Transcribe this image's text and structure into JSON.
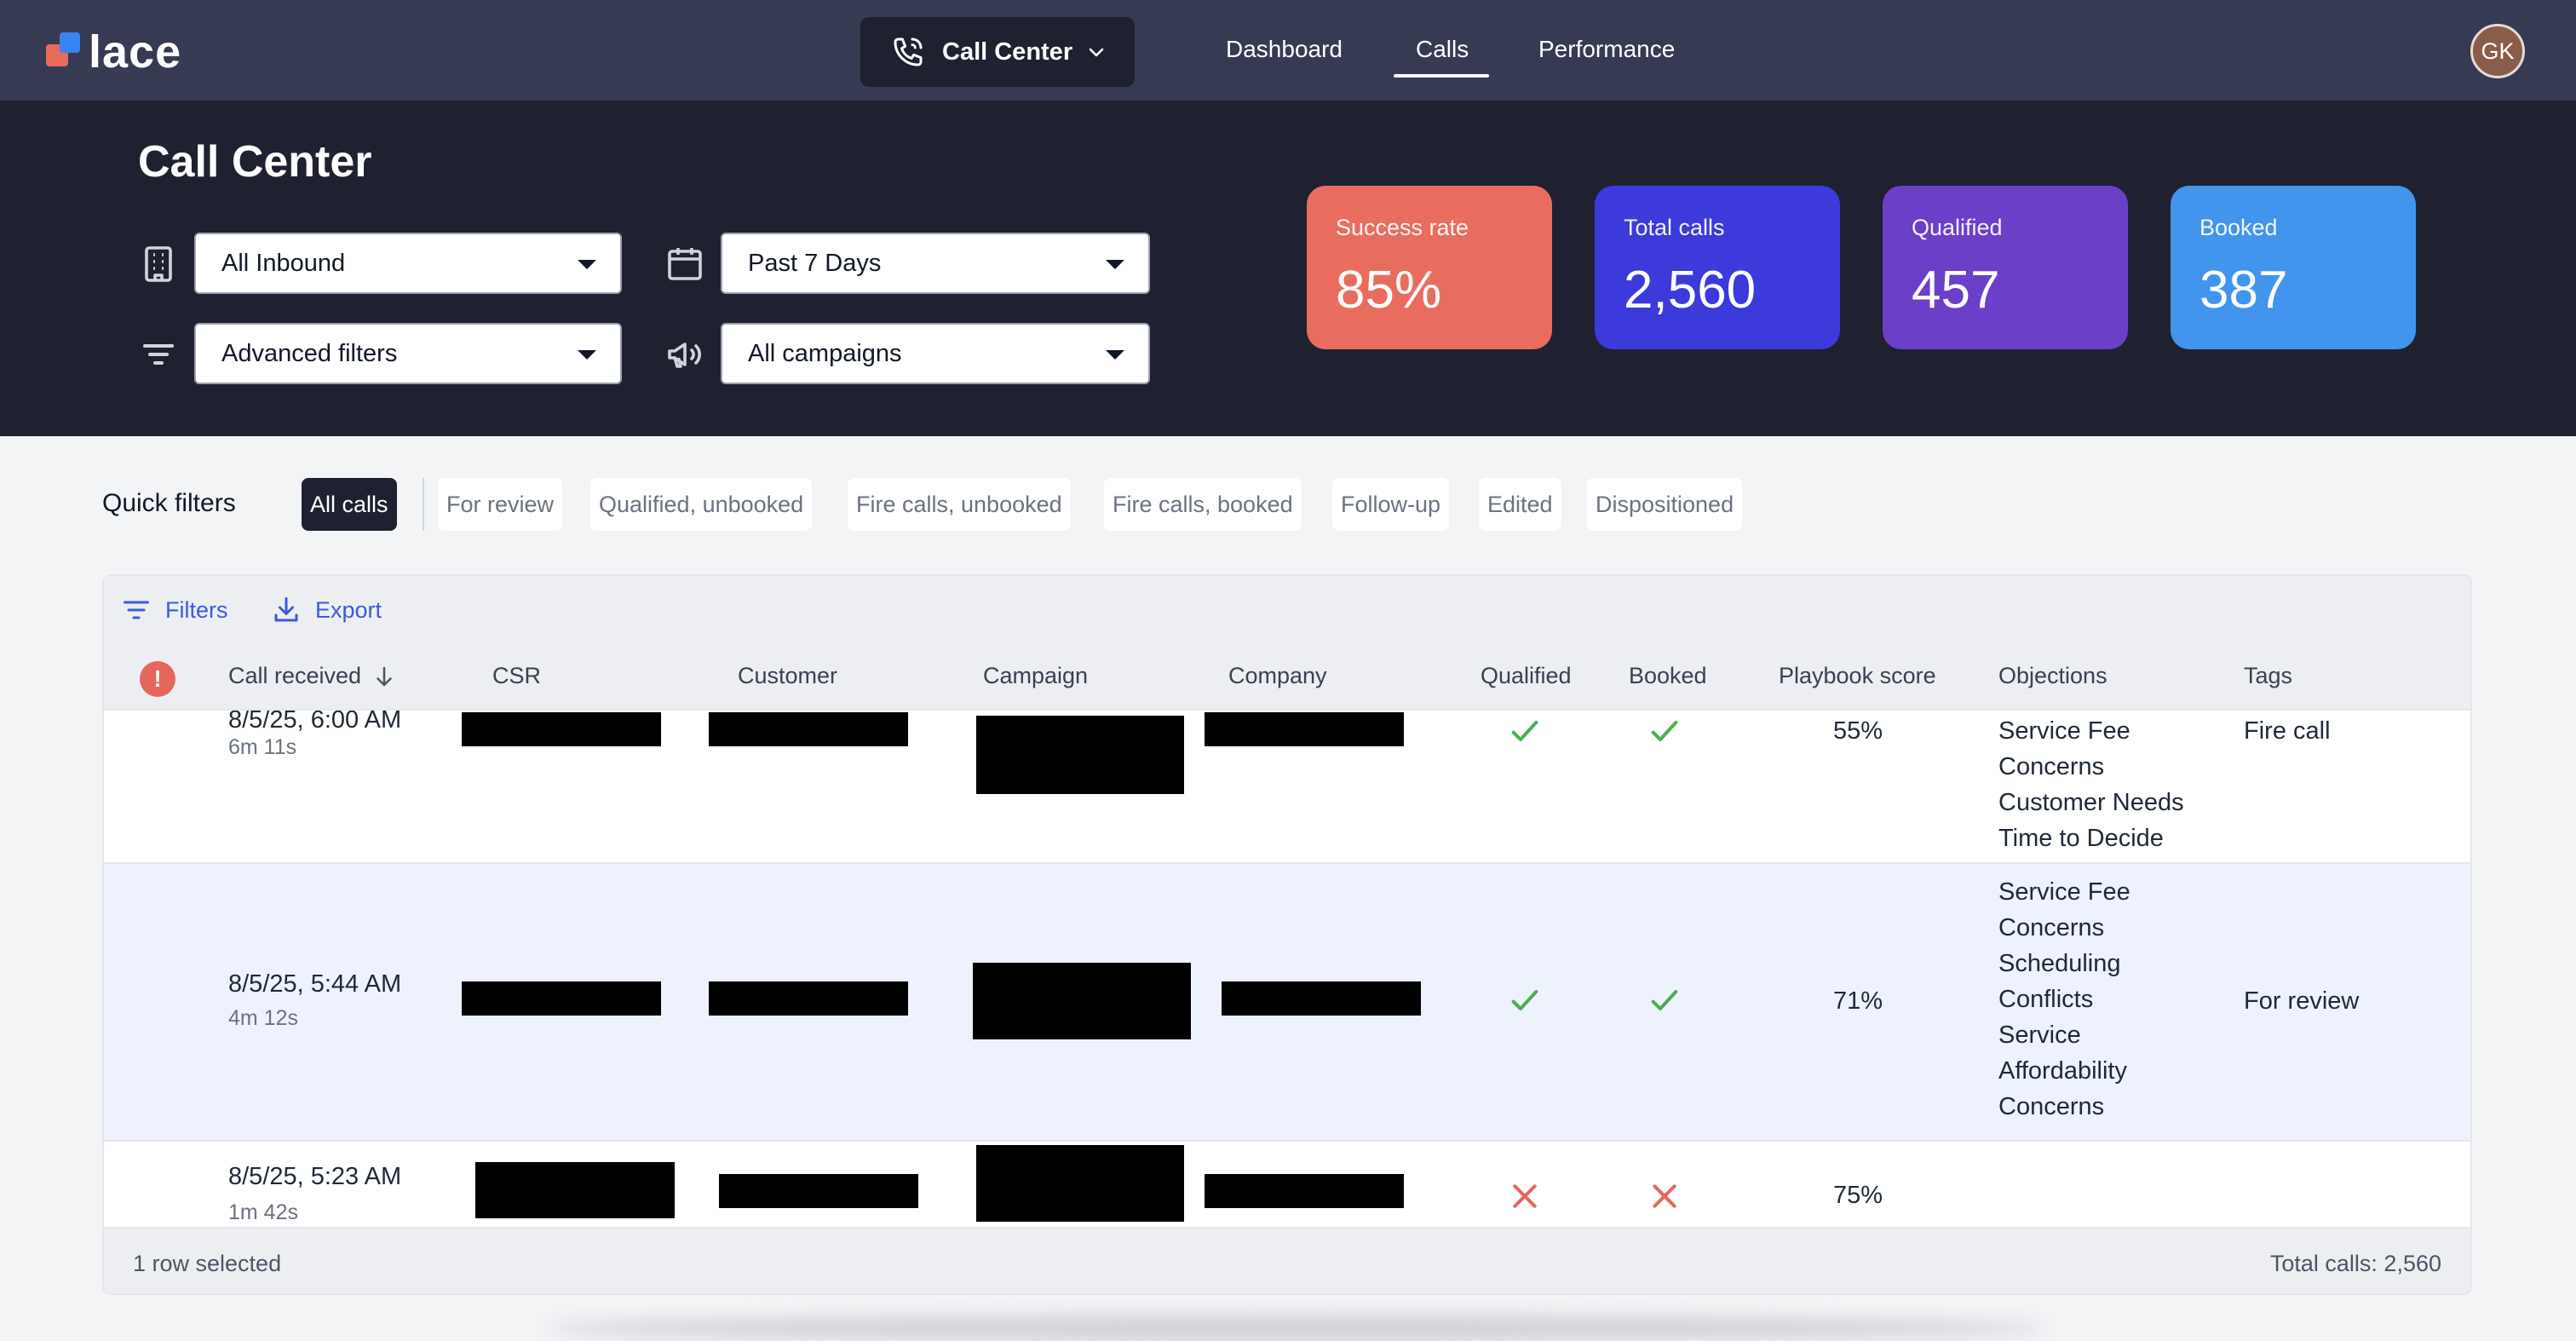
{
  "app": {
    "logo_text": "lace"
  },
  "header": {
    "product_switcher": {
      "label": "Call Center",
      "icon": "phone-icon"
    },
    "nav": [
      "Dashboard",
      "Calls",
      "Performance"
    ],
    "active_nav": "Calls",
    "avatar_initials": "GK"
  },
  "hero": {
    "title": "Call Center",
    "filters": {
      "direction": "All Inbound",
      "date_range": "Past 7 Days",
      "advanced": "Advanced filters",
      "campaigns": "All campaigns"
    },
    "stats": [
      {
        "label": "Success rate",
        "value": "85%",
        "color": "#e86d5f"
      },
      {
        "label": "Total calls",
        "value": "2,560",
        "color": "#3c3adb"
      },
      {
        "label": "Qualified",
        "value": "457",
        "color": "#6b3fc8"
      },
      {
        "label": "Booked",
        "value": "387",
        "color": "#4295ec"
      }
    ]
  },
  "quick_filters": {
    "label": "Quick filters",
    "chips": [
      "All calls",
      "For review",
      "Qualified, unbooked",
      "Fire calls, unbooked",
      "Fire calls, booked",
      "Follow-up",
      "Edited",
      "Dispositioned"
    ],
    "active": "All calls"
  },
  "table": {
    "toolbar": {
      "filters": "Filters",
      "export": "Export"
    },
    "columns": [
      "Call received",
      "CSR",
      "Customer",
      "Campaign",
      "Company",
      "Qualified",
      "Booked",
      "Playbook score",
      "Objections",
      "Tags"
    ],
    "rows": [
      {
        "received": "8/5/25, 6:00 AM",
        "duration": "6m 11s",
        "qualified": true,
        "booked": true,
        "score": "55%",
        "objections": [
          "Service Fee",
          "Concerns",
          "Customer Needs",
          "Time to Decide"
        ],
        "tag": "Fire call"
      },
      {
        "received": "8/5/25, 5:44 AM",
        "duration": "4m 12s",
        "qualified": true,
        "booked": true,
        "score": "71%",
        "objections": [
          "Service Fee",
          "Concerns",
          "Scheduling",
          "Conflicts",
          "Service",
          "Affordability",
          "Concerns"
        ],
        "tag": "For review"
      },
      {
        "received": "8/5/25, 5:23 AM",
        "duration": "1m 42s",
        "qualified": false,
        "booked": false,
        "score": "75%",
        "objections": [],
        "tag": ""
      }
    ],
    "footer": {
      "selected": "1 row selected",
      "total": "Total calls: 2,560"
    }
  },
  "colors": {
    "check": "#4caf50",
    "cross": "#e5675c",
    "accent": "#3b5bdb"
  }
}
